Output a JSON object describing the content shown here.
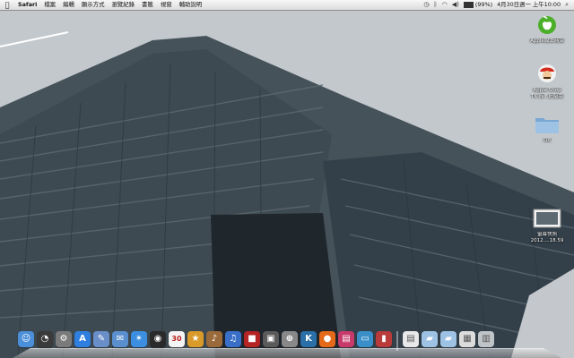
{
  "menubar": {
    "apple_icon": "apple-logo-icon",
    "app_name": "Safari",
    "menus": [
      "檔案",
      "編輯",
      "顯示方式",
      "瀏覽紀錄",
      "書籤",
      "視窗",
      "輔助說明"
    ],
    "status": {
      "battery_text": "(99%)",
      "battery_level": 0.99,
      "clock": "4月30日週一 上午10:00"
    }
  },
  "desktop_icons": [
    {
      "label": "Apple線上商店",
      "icon": "apple-store-icon",
      "color": "#4caf2a"
    },
    {
      "label": "Apple Shop",
      "label2": "TK 族...超級版",
      "icon": "mario-icon",
      "color": "#d42b1e"
    },
    {
      "label": "DB",
      "icon": "folder-icon",
      "color": "#8fb8de"
    },
    {
      "label": "螢幕快照",
      "label2": "2012....18.59",
      "icon": "screenshot-icon",
      "color": "#cccccc"
    }
  ],
  "dock": {
    "items": [
      {
        "name": "finder",
        "color": "#4a8fd8",
        "glyph": "☺"
      },
      {
        "name": "dashboard",
        "color": "#3a3a3a",
        "glyph": "◔"
      },
      {
        "name": "system-preferences",
        "color": "#7a7a7a",
        "glyph": "⚙"
      },
      {
        "name": "app-store",
        "color": "#2f7fe0",
        "glyph": "A"
      },
      {
        "name": "preview",
        "color": "#6a8fc8",
        "glyph": "✎"
      },
      {
        "name": "mail",
        "color": "#5a8fcf",
        "glyph": "✉"
      },
      {
        "name": "safari",
        "color": "#3b8ee0",
        "glyph": "✴"
      },
      {
        "name": "facetime",
        "color": "#2a2a2a",
        "glyph": "◉"
      },
      {
        "name": "calendar",
        "color": "#f4f4f4",
        "glyph": "30"
      },
      {
        "name": "garageband",
        "color": "#d99a2a",
        "glyph": "★"
      },
      {
        "name": "guitar",
        "color": "#9a6a3a",
        "glyph": "♪"
      },
      {
        "name": "itunes",
        "color": "#3a6fc8",
        "glyph": "♫"
      },
      {
        "name": "photo-booth",
        "color": "#b42424",
        "glyph": "■"
      },
      {
        "name": "iphoto",
        "color": "#5a5a5a",
        "glyph": "▣"
      },
      {
        "name": "time-machine",
        "color": "#888888",
        "glyph": "⊕"
      },
      {
        "name": "kindle",
        "color": "#2a6fa8",
        "glyph": "K"
      },
      {
        "name": "orb",
        "color": "#e46a1a",
        "glyph": "●"
      },
      {
        "name": "books",
        "color": "#c83a6a",
        "glyph": "▤"
      },
      {
        "name": "monitor",
        "color": "#3a8fc8",
        "glyph": "▭"
      },
      {
        "name": "bars",
        "color": "#b83a3a",
        "glyph": "▮"
      }
    ],
    "right_items": [
      {
        "name": "documents",
        "color": "#e8e8e8",
        "glyph": "▤"
      },
      {
        "name": "applications-folder",
        "color": "#9ec2e4",
        "glyph": "▰"
      },
      {
        "name": "downloads-folder",
        "color": "#9ec2e4",
        "glyph": "▰"
      },
      {
        "name": "stack",
        "color": "#dcdcdc",
        "glyph": "▦"
      },
      {
        "name": "trash",
        "color": "#bfc4c8",
        "glyph": "▥"
      }
    ]
  }
}
